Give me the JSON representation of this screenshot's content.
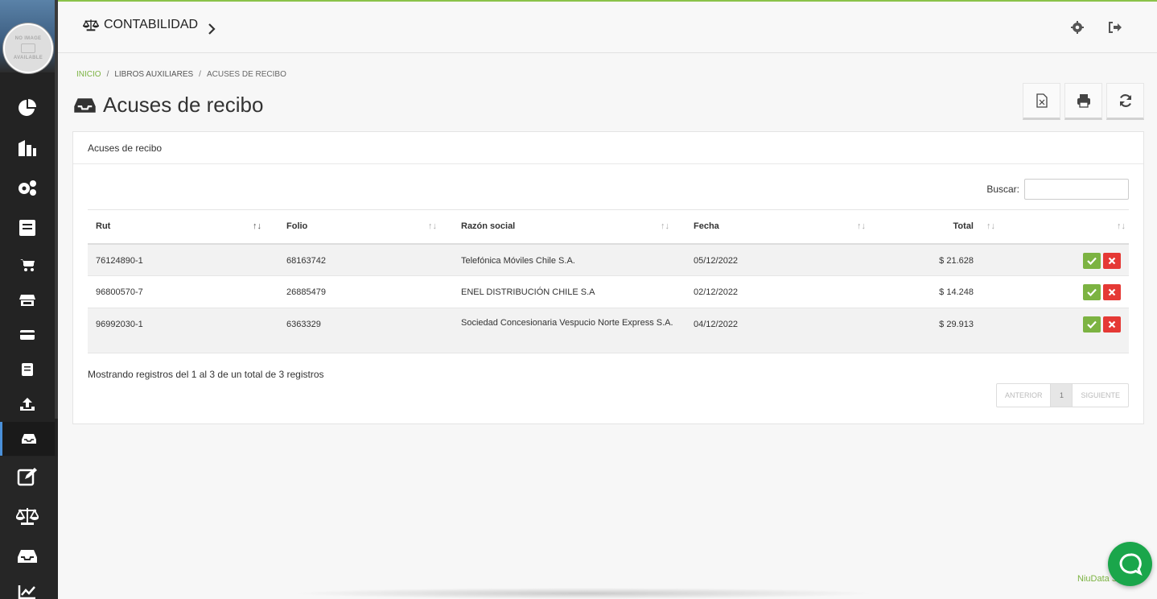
{
  "sidebar": {
    "avatar_text_1": "NO IMAGE",
    "avatar_text_2": "AVAILABLE",
    "items": [
      {
        "icon": "pie-chart-icon"
      },
      {
        "icon": "building-icon"
      },
      {
        "icon": "gears-icon"
      },
      {
        "icon": "book-icon"
      },
      {
        "icon": "cart-icon"
      },
      {
        "icon": "store-icon"
      },
      {
        "icon": "credit-card-icon"
      },
      {
        "icon": "book-small-icon"
      },
      {
        "icon": "upload-icon"
      },
      {
        "icon": "inbox-icon",
        "active": true
      },
      {
        "icon": "edit-icon"
      },
      {
        "icon": "balance-scale-icon"
      },
      {
        "icon": "inbox-large-icon"
      },
      {
        "icon": "line-chart-icon"
      }
    ]
  },
  "topbar": {
    "module_title": "CONTABILIDAD",
    "icons": [
      "settings-icon",
      "logout-icon"
    ]
  },
  "breadcrumb": {
    "home": "INICIO",
    "section": "LIBROS AUXILIARES",
    "current": "ACUSES DE RECIBO",
    "separator": "/"
  },
  "page": {
    "title": "Acuses de recibo",
    "toolbar": [
      "excel-icon",
      "print-icon",
      "refresh-icon"
    ]
  },
  "panel": {
    "heading": "Acuses de recibo",
    "search_label": "Buscar:",
    "search_value": "",
    "columns": [
      "Rut",
      "Folio",
      "Razón social",
      "Fecha",
      "Total"
    ],
    "rows": [
      {
        "rut": "76124890-1",
        "folio": "68163742",
        "razon_social": "Telefónica Móviles Chile S.A.",
        "fecha": "05/12/2022",
        "total": "$ 21.628"
      },
      {
        "rut": "96800570-7",
        "folio": "26885479",
        "razon_social": "ENEL DISTRIBUCIÓN CHILE S.A",
        "fecha": "02/12/2022",
        "total": "$ 14.248"
      },
      {
        "rut": "96992030-1",
        "folio": "6363329",
        "razon_social": "Sociedad Concesionaria Vespucio Norte Express S.A.",
        "fecha": "04/12/2022",
        "total": "$ 29.913"
      }
    ],
    "info": "Mostrando registros del 1 al 3 de un total de 3 registros",
    "pager": {
      "prev": "ANTERIOR",
      "page": "1",
      "next": "SIGUIENTE"
    }
  },
  "footer": {
    "brand": "NiuData S"
  },
  "colors": {
    "accent_green": "#7cb342",
    "danger": "#e53935",
    "sidebar": "#232323",
    "chat": "#1aa64b"
  }
}
